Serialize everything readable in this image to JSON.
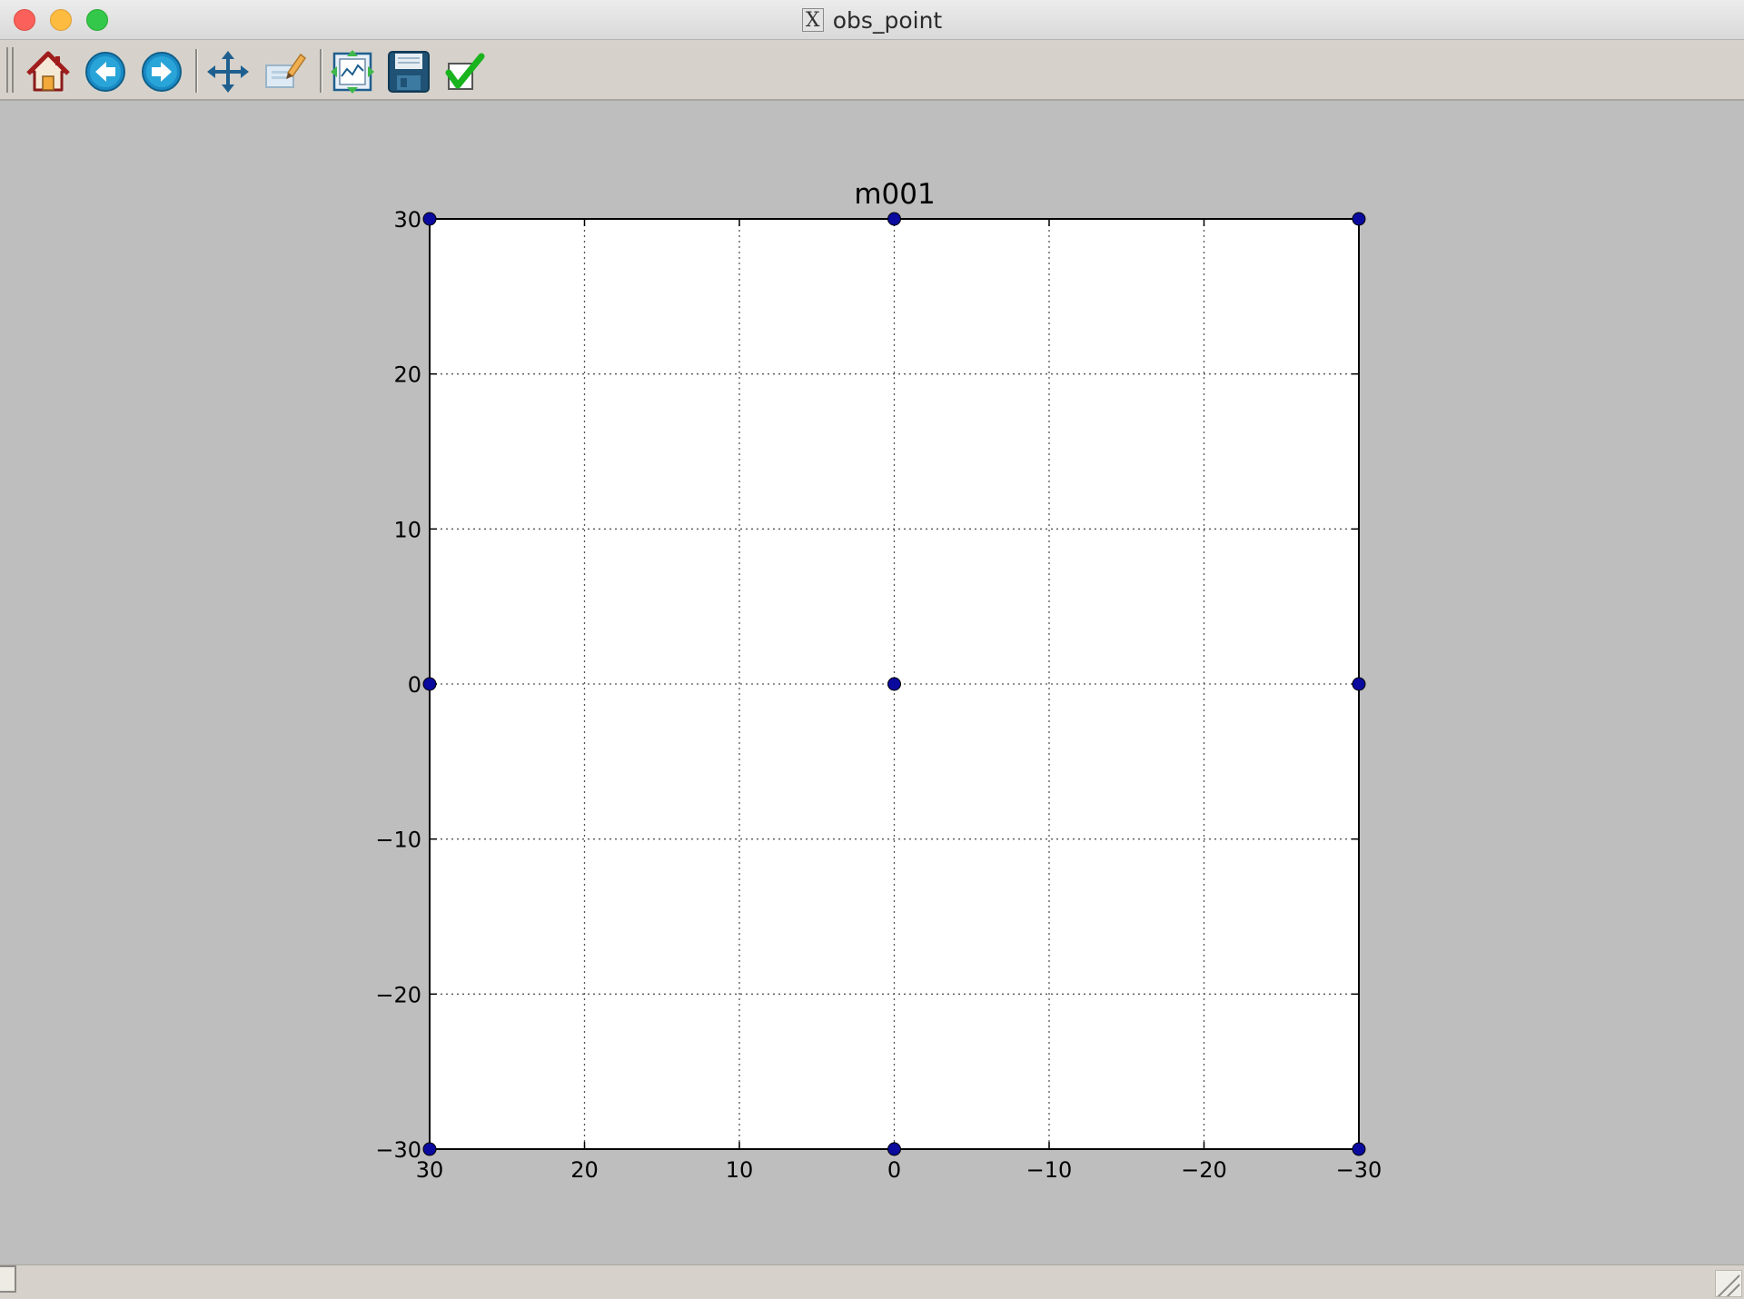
{
  "window": {
    "title": "obs_point"
  },
  "toolbar": {
    "buttons": [
      {
        "id": "home",
        "icon": "home-icon"
      },
      {
        "id": "back",
        "icon": "back-arrow-icon"
      },
      {
        "id": "forward",
        "icon": "forward-arrow-icon"
      },
      {
        "id": "pan",
        "icon": "pan-move-icon"
      },
      {
        "id": "zoom",
        "icon": "zoom-rect-icon"
      },
      {
        "id": "subplots",
        "icon": "subplot-config-icon"
      },
      {
        "id": "save",
        "icon": "save-disk-icon"
      },
      {
        "id": "check",
        "icon": "checkmark-icon"
      }
    ]
  },
  "colors": {
    "canvas_background": "#bebebe",
    "plot_background": "#ffffff",
    "marker": "#0a0a9e",
    "grid": "#555555"
  },
  "chart_data": {
    "type": "scatter",
    "title": "m001",
    "xlabel": "",
    "ylabel": "",
    "xlim": [
      30,
      -30
    ],
    "ylim": [
      -30,
      30
    ],
    "x_inverted": true,
    "xticks": [
      "30",
      "20",
      "10",
      "0",
      "−10",
      "−20",
      "−30"
    ],
    "xtick_values": [
      30,
      20,
      10,
      0,
      -10,
      -20,
      -30
    ],
    "yticks": [
      "30",
      "20",
      "10",
      "0",
      "−10",
      "−20",
      "−30"
    ],
    "ytick_values": [
      30,
      20,
      10,
      0,
      -10,
      -20,
      -30
    ],
    "grid": true,
    "grid_style": "dotted",
    "series": [
      {
        "marker": "circle",
        "points": [
          {
            "x": 30,
            "y": 30
          },
          {
            "x": 0,
            "y": 30
          },
          {
            "x": -30,
            "y": 30
          },
          {
            "x": 30,
            "y": 0
          },
          {
            "x": 0,
            "y": 0
          },
          {
            "x": -30,
            "y": 0
          },
          {
            "x": 30,
            "y": -30
          },
          {
            "x": 0,
            "y": -30
          },
          {
            "x": -30,
            "y": -30
          }
        ]
      }
    ]
  }
}
